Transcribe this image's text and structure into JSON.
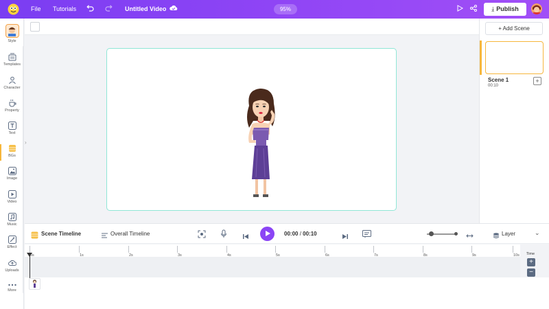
{
  "topbar": {
    "menu": [
      "File",
      "Tutorials"
    ],
    "title": "Untitled Video",
    "zoom": "95%",
    "publish_label": "Publish",
    "icons": [
      "undo-icon",
      "redo-icon",
      "cloud-save-icon",
      "preview-play-icon",
      "share-icon"
    ]
  },
  "sidebar": {
    "items": [
      {
        "label": "Style",
        "icon": "style-avatar-icon"
      },
      {
        "label": "Templates",
        "icon": "templates-icon"
      },
      {
        "label": "Character",
        "icon": "character-icon"
      },
      {
        "label": "Property",
        "icon": "property-icon"
      },
      {
        "label": "Text",
        "icon": "text-icon"
      },
      {
        "label": "BGs",
        "icon": "backgrounds-icon"
      },
      {
        "label": "Image",
        "icon": "image-icon"
      },
      {
        "label": "Video",
        "icon": "video-icon"
      },
      {
        "label": "Music",
        "icon": "music-icon"
      },
      {
        "label": "Effect",
        "icon": "effect-icon"
      },
      {
        "label": "Uploads",
        "icon": "uploads-icon"
      },
      {
        "label": "More",
        "icon": "more-icon"
      }
    ]
  },
  "scenes": {
    "add_label": "+ Add Scene",
    "list": [
      {
        "name": "Scene 1",
        "duration": "00:10"
      }
    ]
  },
  "timeline": {
    "scene_tab": "Scene Timeline",
    "overall_tab": "Overall Timeline",
    "current_time": "00:00",
    "total_time": "00:10",
    "separator": " / ",
    "layer_label": "Layer",
    "ruler": [
      "0s",
      "1s",
      "2s",
      "3s",
      "4s",
      "5s",
      "6s",
      "7s",
      "8s",
      "9s",
      "10s"
    ],
    "time_label": "Time"
  },
  "colors": {
    "brand_purple": "#8b45f5",
    "accent_orange": "#f6b63b",
    "canvas_border": "#8fe6d6"
  }
}
